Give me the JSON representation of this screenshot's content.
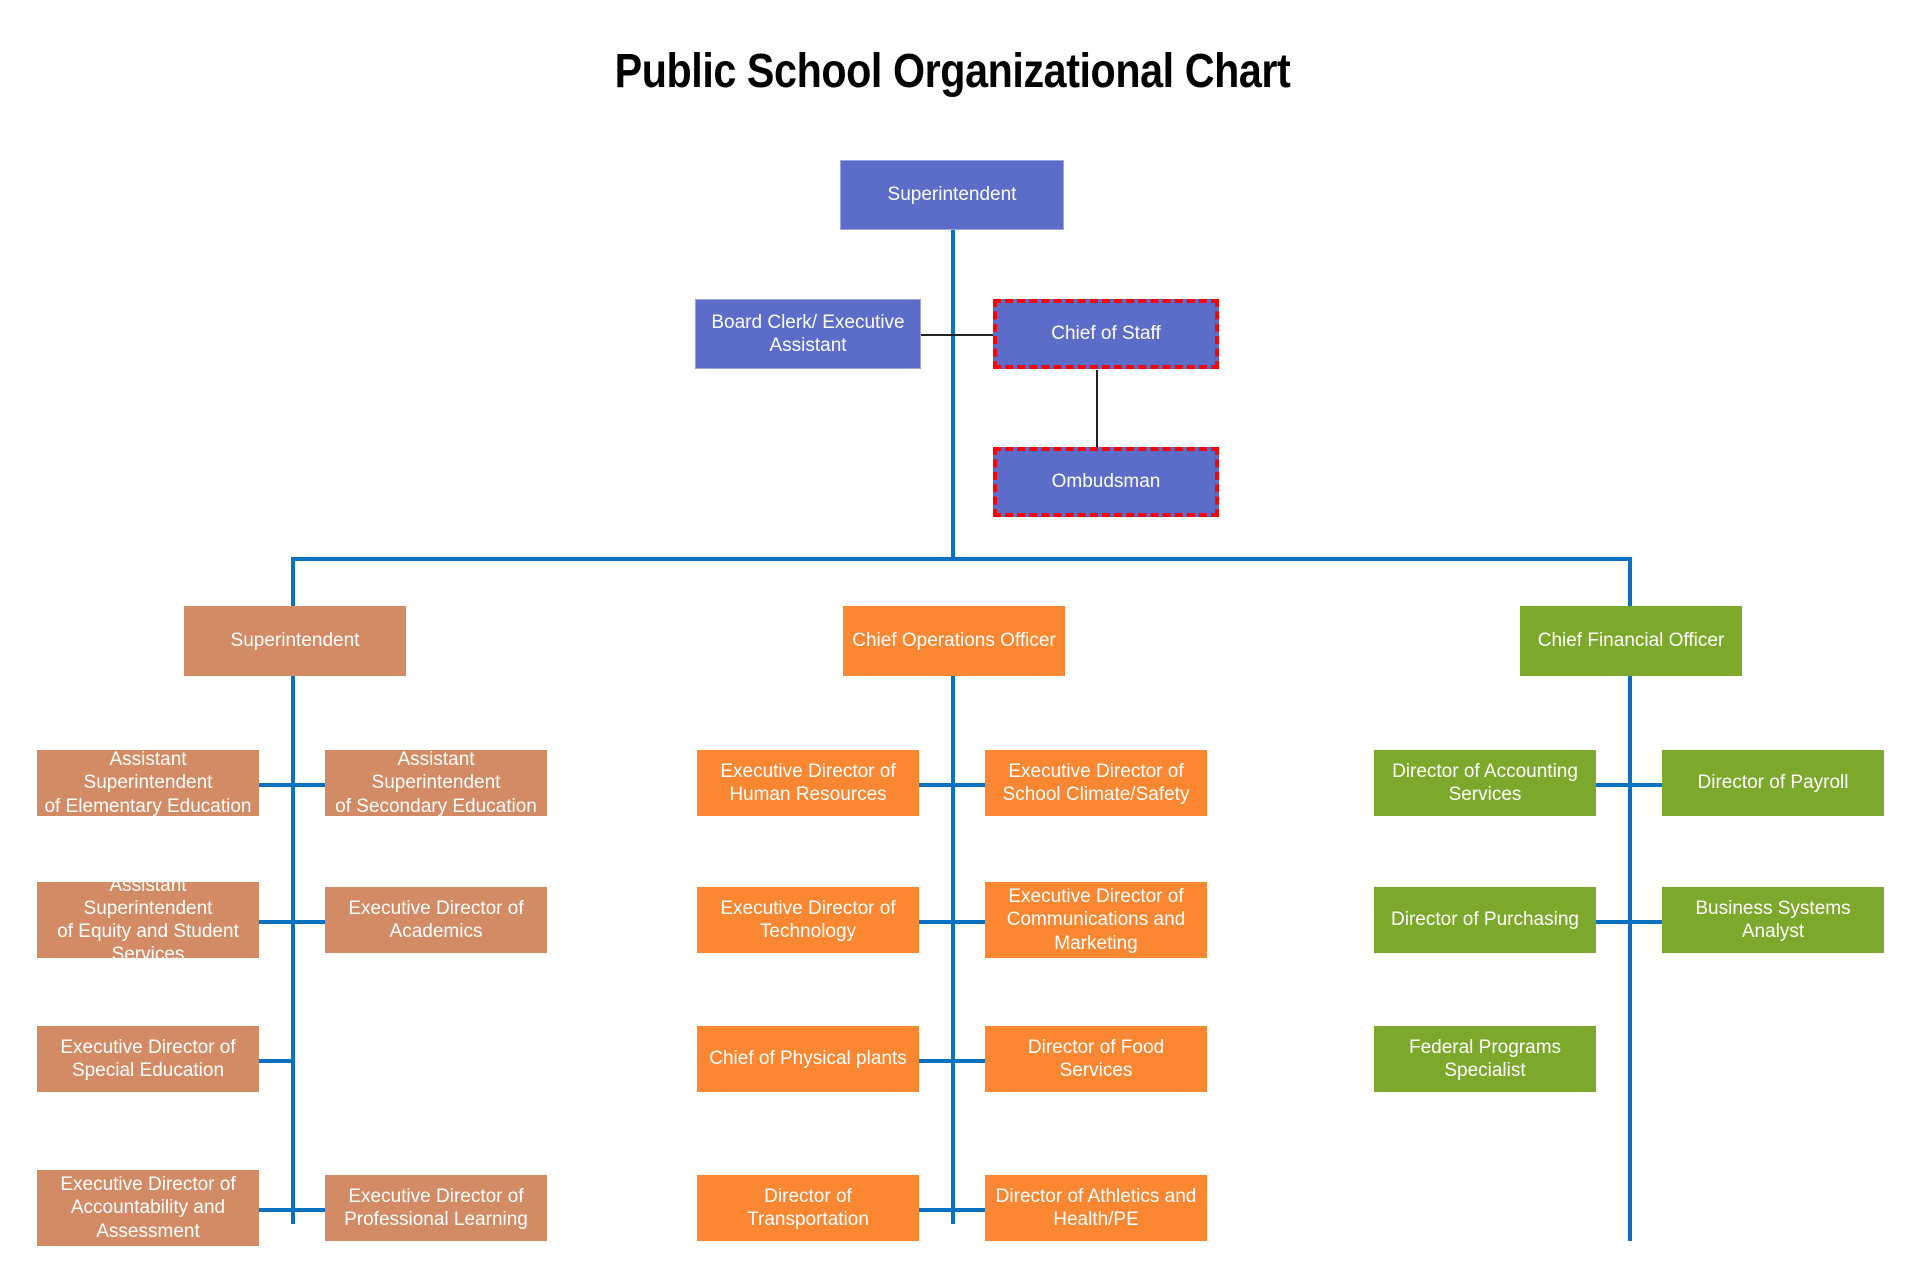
{
  "title": "Public School Organizational Chart",
  "colors": {
    "blue": "#5B6DC8",
    "salmon": "#D38B66",
    "orange": "#FB8732",
    "green": "#7CA82C",
    "connector": "#0A71C0",
    "selection": "#FF0000",
    "text": "#FFFFFF",
    "title": "#000000",
    "background": "#FFFFFF"
  },
  "chart_data": {
    "type": "diagram",
    "diagram_kind": "organizational-chart",
    "title": "Public School Organizational Chart",
    "nodes": [
      {
        "id": "superintendent_top",
        "label": "Superintendent",
        "color": "#5B6DC8",
        "tier": 0,
        "selected": false
      },
      {
        "id": "board_clerk",
        "label": "Board Clerk/ Executive\nAssistant",
        "color": "#5B6DC8",
        "tier": 1,
        "selected": false
      },
      {
        "id": "chief_of_staff",
        "label": "Chief of Staff",
        "color": "#5B6DC8",
        "tier": 1,
        "selected": true
      },
      {
        "id": "ombudsman",
        "label": "Ombudsman",
        "color": "#5B6DC8",
        "tier": 2,
        "selected": true
      },
      {
        "id": "superintendent_left",
        "label": "Superintendent",
        "color": "#D38B66",
        "tier": 2,
        "selected": false
      },
      {
        "id": "chief_operations_officer",
        "label": "Chief Operations Officer",
        "color": "#FB8732",
        "tier": 2,
        "selected": false
      },
      {
        "id": "chief_financial_officer",
        "label": "Chief Financial Officer",
        "color": "#7CA82C",
        "tier": 2,
        "selected": false
      }
    ],
    "edges": [
      {
        "from": "superintendent_top",
        "to": "chief_of_staff"
      },
      {
        "from": "board_clerk",
        "to": "chief_of_staff"
      },
      {
        "from": "chief_of_staff",
        "to": "ombudsman"
      },
      {
        "from": "superintendent_top",
        "to": "superintendent_left"
      },
      {
        "from": "superintendent_top",
        "to": "chief_operations_officer"
      },
      {
        "from": "superintendent_top",
        "to": "chief_financial_officer"
      }
    ]
  },
  "top": {
    "superintendent": "Superintendent",
    "board_clerk": "Board Clerk/ Executive\nAssistant",
    "chief_of_staff": "Chief of Staff",
    "ombudsman": "Ombudsman"
  },
  "columns": {
    "academics": {
      "head": "Superintendent",
      "left_items": [
        "Assistant Superintendent\nof Elementary Education",
        "Assistant Superintendent\nof Equity and Student\nServices",
        "Executive Director of\nSpecial Education",
        "Executive Director of\nAccountability  and\nAssessment"
      ],
      "right_items": [
        "Assistant Superintendent\nof Secondary Education",
        "Executive Director of\nAcademics",
        "",
        "Executive Director of\nProfessional Learning"
      ]
    },
    "operations": {
      "head": "Chief Operations Officer",
      "left_items": [
        "Executive Director of\nHuman Resources",
        "Executive Director of\nTechnology",
        "Chief  of Physical plants",
        "Director of\nTransportation"
      ],
      "right_items": [
        "Executive Director of\nSchool Climate/Safety",
        "Executive Director of\nCommunications and\nMarketing",
        "Director of Food\nServices",
        "Director of Athletics and\nHealth/PE"
      ]
    },
    "finance": {
      "head": "Chief Financial Officer",
      "left_items": [
        "Director of Accounting\nServices",
        "Director of Purchasing",
        "Federal Programs\nSpecialist"
      ],
      "right_items": [
        "Director of Payroll",
        "Business Systems\nAnalyst",
        ""
      ]
    }
  }
}
